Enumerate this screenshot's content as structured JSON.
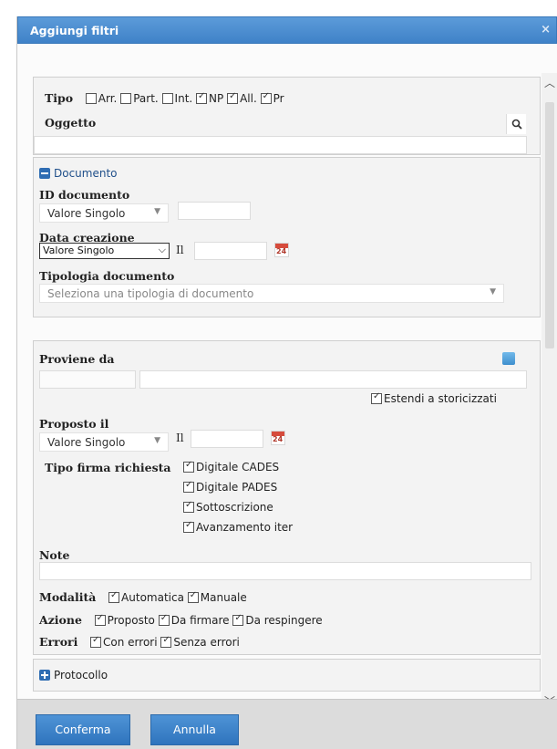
{
  "dialog": {
    "title": "Aggiungi filtri",
    "close_label": "×"
  },
  "tipo": {
    "label": "Tipo",
    "options": [
      {
        "label": "Arr.",
        "checked": false
      },
      {
        "label": "Part.",
        "checked": false
      },
      {
        "label": "Int.",
        "checked": false
      },
      {
        "label": "NP",
        "checked": true
      },
      {
        "label": "All.",
        "checked": true
      },
      {
        "label": "Pr",
        "checked": true
      }
    ]
  },
  "oggetto": {
    "label": "Oggetto",
    "value": ""
  },
  "documento": {
    "section_label": "Documento",
    "id_label": "ID documento",
    "id_mode": "Valore Singolo",
    "data_creazione_label": "Data creazione",
    "data_creazione_mode": "Valore Singolo",
    "il_label": "Il",
    "calendar_day": "24",
    "tipologia_label": "Tipologia documento",
    "tipologia_placeholder": "Seleziona una tipologia di documento"
  },
  "proviene": {
    "label": "Proviene da",
    "estendi_label": "Estendi a storicizzati",
    "estendi_checked": true
  },
  "proposto": {
    "label": "Proposto il",
    "mode": "Valore Singolo",
    "il_label": "Il",
    "calendar_day": "24"
  },
  "firma": {
    "label": "Tipo firma richiesta",
    "options": [
      {
        "label": "Digitale CADES",
        "checked": true
      },
      {
        "label": "Digitale PADES",
        "checked": true
      },
      {
        "label": "Sottoscrizione",
        "checked": true
      },
      {
        "label": "Avanzamento iter",
        "checked": true
      }
    ]
  },
  "note": {
    "label": "Note",
    "value": ""
  },
  "modalita": {
    "label": "Modalità",
    "options": [
      {
        "label": "Automatica",
        "checked": true
      },
      {
        "label": "Manuale",
        "checked": true
      }
    ]
  },
  "azione": {
    "label": "Azione",
    "options": [
      {
        "label": "Proposto",
        "checked": true
      },
      {
        "label": "Da firmare",
        "checked": true
      },
      {
        "label": "Da respingere",
        "checked": true
      }
    ]
  },
  "errori": {
    "label": "Errori",
    "options": [
      {
        "label": "Con errori",
        "checked": true
      },
      {
        "label": "Senza errori",
        "checked": true
      }
    ]
  },
  "protocollo": {
    "section_label": "Protocollo"
  },
  "footer": {
    "confirm_label": "Conferma",
    "cancel_label": "Annulla"
  },
  "colors": {
    "titlebar": "#4a8bd0",
    "button": "#3f82c8",
    "calendar_red": "#d64b3c"
  }
}
